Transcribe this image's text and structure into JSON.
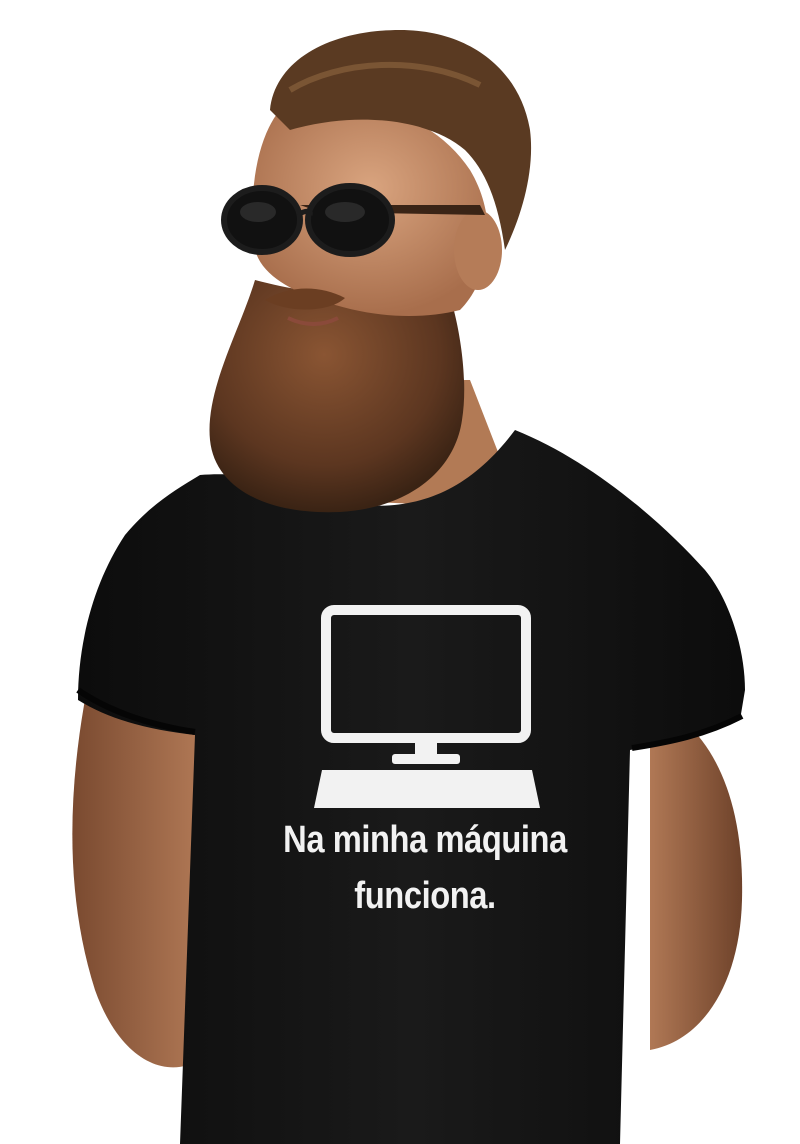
{
  "photo": {
    "subject": "bearded man wearing sunglasses and a black t-shirt",
    "shirt_color": "#121212",
    "background_color": "#ffffff",
    "print_color": "#f2f2f2"
  },
  "shirt_print": {
    "icon": "desktop-computer-icon",
    "line1": "Na minha máquina",
    "line2": "funciona."
  }
}
